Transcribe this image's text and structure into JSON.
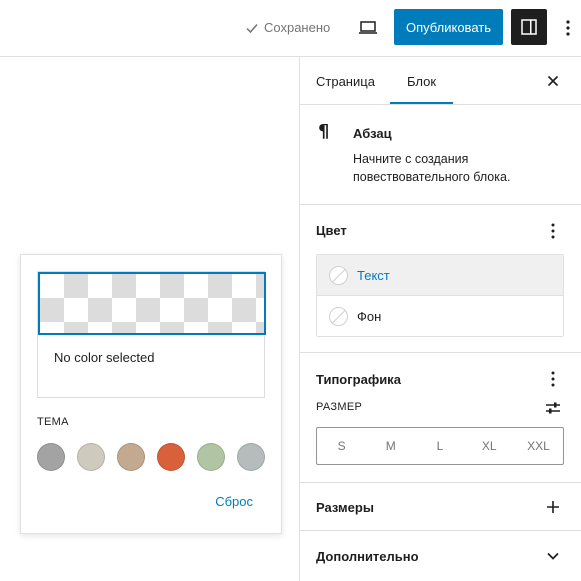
{
  "toolbar": {
    "saved_label": "Сохранено",
    "publish_label": "Опубликовать"
  },
  "color_popover": {
    "no_color_label": "No color selected",
    "theme_label": "ТЕМА",
    "swatches": [
      "#a3a3a3",
      "#cfcabe",
      "#c2a990",
      "#d8613c",
      "#b1c5a4",
      "#b5bdbc"
    ],
    "reset_label": "Сброс"
  },
  "sidebar": {
    "tabs": [
      "Страница",
      "Блок"
    ],
    "block": {
      "title": "Абзац",
      "description": "Начните с создания повествовательного блока."
    },
    "color_panel": {
      "title": "Цвет",
      "items": [
        "Текст",
        "Фон"
      ]
    },
    "typography_panel": {
      "title": "Типографика",
      "size_label": "РАЗМЕР",
      "sizes": [
        "S",
        "M",
        "L",
        "XL",
        "XXL"
      ]
    },
    "dimensions_panel": {
      "title": "Размеры"
    },
    "advanced_panel": {
      "title": "Дополнительно"
    }
  },
  "colors": {
    "accent": "#007cba",
    "dark": "#1e1e1e",
    "border": "#e0e0e0"
  }
}
